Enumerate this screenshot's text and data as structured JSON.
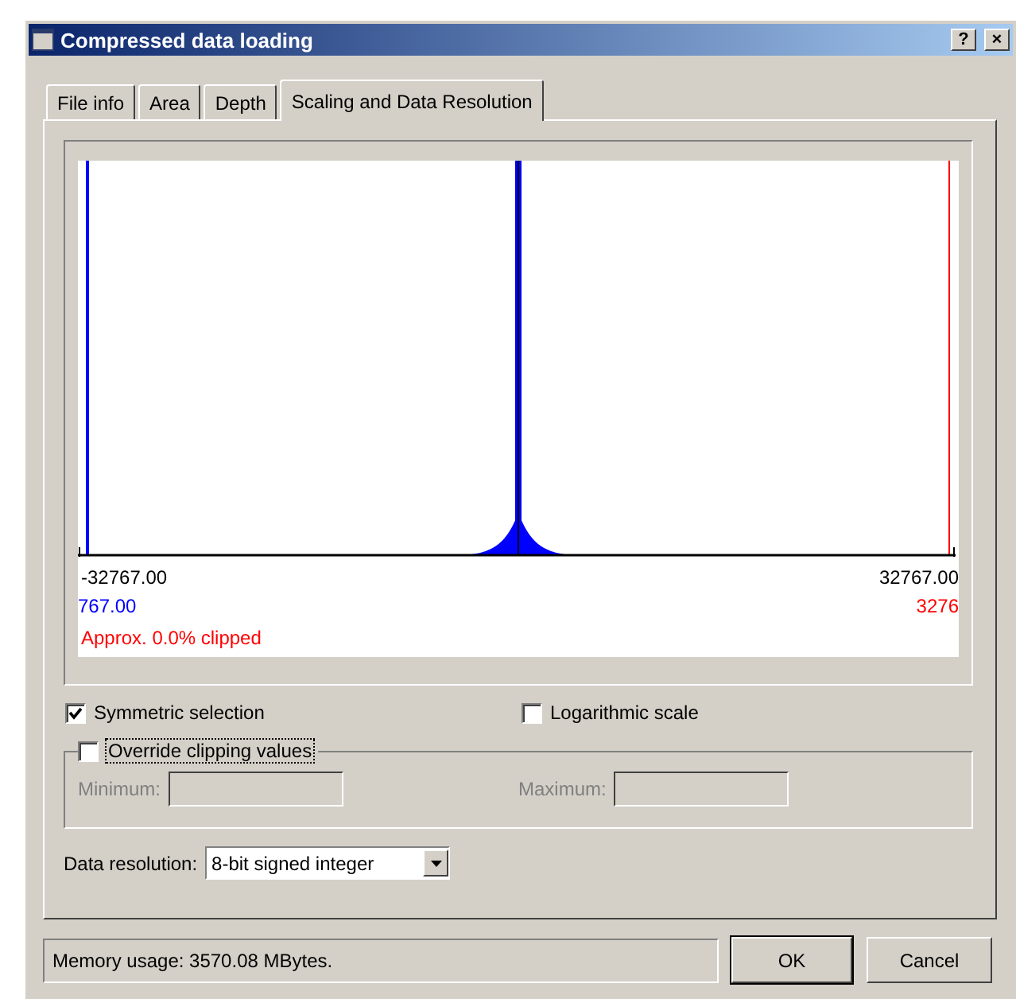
{
  "window": {
    "title": "Compressed data loading",
    "title_buttons": [
      "?",
      "×"
    ]
  },
  "tabs": [
    {
      "label": "File info",
      "selected": false
    },
    {
      "label": "Area",
      "selected": false
    },
    {
      "label": "Depth",
      "selected": false
    },
    {
      "label": "Scaling and Data Resolution",
      "selected": true
    }
  ],
  "histogram": {
    "axis_min": "-32767.00",
    "axis_max": "32767.00",
    "low_value": "767.00",
    "high_value": "3276",
    "clipped_note": "Approx. 0.0% clipped"
  },
  "options": [
    {
      "label": "Symmetric selection",
      "checked": true
    },
    {
      "label": "Logarithmic scale",
      "checked": false
    }
  ],
  "clipping": {
    "label": "Override clipping values",
    "checked": false,
    "fields": [
      {
        "label": "Minimum:",
        "disabled": true
      },
      {
        "label": "Maximum:",
        "disabled": true
      }
    ]
  },
  "data_resolution": {
    "label": "Data resolution:",
    "value": "8-bit signed integer"
  },
  "status": {
    "memory_usage": "Memory usage: 3570.08 MBytes."
  },
  "buttons": [
    {
      "label": "OK",
      "default": true
    },
    {
      "label": "Cancel",
      "default": false
    }
  ]
}
